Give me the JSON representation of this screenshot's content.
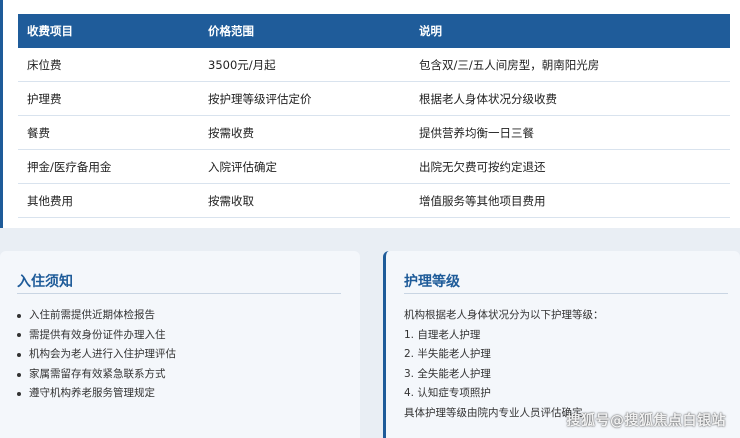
{
  "fee_table": {
    "headers": [
      "收费项目",
      "价格范围",
      "说明"
    ],
    "rows": [
      [
        "床位费",
        "3500元/月起",
        "包含双/三/五人间房型，朝南阳光房"
      ],
      [
        "护理费",
        "按护理等级评估定价",
        "根据老人身体状况分级收费"
      ],
      [
        "餐费",
        "按需收费",
        "提供营养均衡一日三餐"
      ],
      [
        "押金/医疗备用金",
        "入院评估确定",
        "出院无欠费可按约定退还"
      ],
      [
        "其他费用",
        "按需收取",
        "增值服务等其他项目费用"
      ]
    ]
  },
  "notice": {
    "title": "入住须知",
    "items": [
      "入住前需提供近期体检报告",
      "需提供有效身份证件办理入住",
      "机构会为老人进行入住护理评估",
      "家属需留存有效紧急联系方式",
      "遵守机构养老服务管理规定"
    ]
  },
  "care_level": {
    "title": "护理等级",
    "intro": "机构根据老人身体状况分为以下护理等级：",
    "levels": [
      "1. 自理老人护理",
      "2. 半失能老人护理",
      "3. 全失能老人护理",
      "4. 认知症专项照护"
    ],
    "footer": "具体护理等级由院内专业人员评估确定"
  },
  "watermark": "搜狐号@搜狐焦点白银站",
  "colors": {
    "accent": "#1f5c9a",
    "card_bg": "#f4f7fb"
  }
}
